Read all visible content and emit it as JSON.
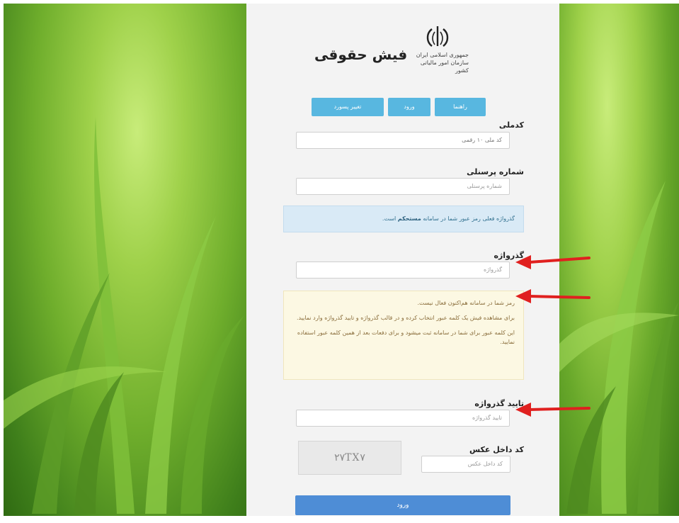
{
  "header": {
    "title": "فیش حقوقی",
    "org_lines": [
      "جمهوری اسلامی ایران",
      "سازمان امور مالیاتی",
      "کشور"
    ]
  },
  "tabs": [
    {
      "label": "راهنما"
    },
    {
      "label": "ورود"
    },
    {
      "label": "تغییر پسورد"
    }
  ],
  "form": {
    "national_code": {
      "label": "کدملی",
      "value": "کد ملی ۱۰ رقمی"
    },
    "personnel_number": {
      "label": "شماره پرسنلی",
      "placeholder": "شماره پرسنلی"
    },
    "info_message": {
      "prefix": "گذرواژه فعلی رمز عبور شما در سامانه",
      "strong": "مستحکم",
      "suffix": "است."
    },
    "password": {
      "label": "گذرواژه",
      "placeholder": "گذرواژه"
    },
    "warning": [
      "رمز شما در سامانه هم‌اکنون فعال نیست.",
      "برای مشاهده فیش یک کلمه عبور انتخاب کرده و در قالب گذرواژه و تایید گذرواژه وارد نمایید.",
      "این کلمه عبور برای شما در سامانه ثبت میشود و برای دفعات بعد از همین کلمه عبور استفاده نمایید."
    ],
    "confirm_password": {
      "label": "تایید گذرواژه",
      "placeholder": "تایید گذرواژه"
    },
    "captcha": {
      "label": "کد داخل عکس",
      "image_text": "۲۷TX۷",
      "placeholder": "کد داخل عکس"
    },
    "submit_label": "ورود"
  },
  "colors": {
    "tab": "#58b7e0",
    "submit": "#4e8dd6",
    "arrow": "#e0201f",
    "info_bg": "#d9eaf6",
    "warn_bg": "#fcf8e3"
  }
}
